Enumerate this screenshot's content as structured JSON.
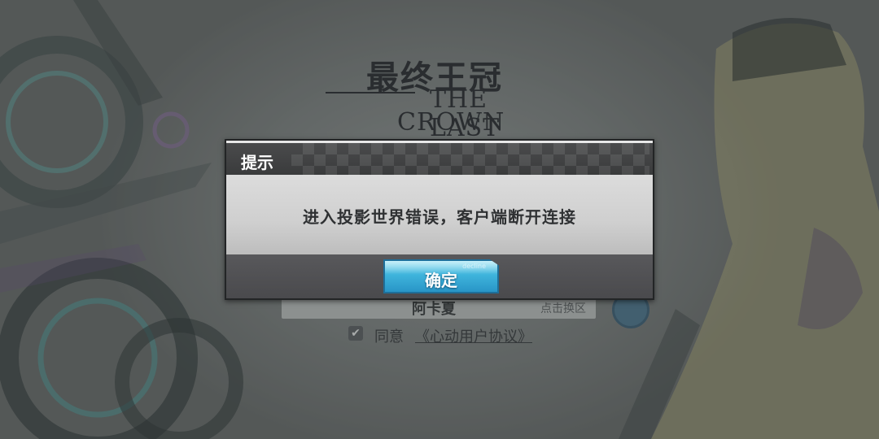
{
  "logo": {
    "title_cn": "最终王冠",
    "title_en_line1": "THE LAST",
    "title_en_line2": "CROWN"
  },
  "login": {
    "account_name": "阿卡夏",
    "switch_region_label": "点击换区",
    "agree_checked": true,
    "agree_prefix": "同意",
    "agree_link": "《心动用户协议》"
  },
  "dialog": {
    "title": "提示",
    "message": "进入投影世界错误，客户端断开连接",
    "confirm_label": "确定",
    "button_deco": "decline"
  },
  "colors": {
    "button_blue": "#3fb4dc",
    "dialog_header": "#3a3b3c",
    "dialog_body": "#d2d2d2",
    "dialog_footer": "#4a4a4d"
  }
}
